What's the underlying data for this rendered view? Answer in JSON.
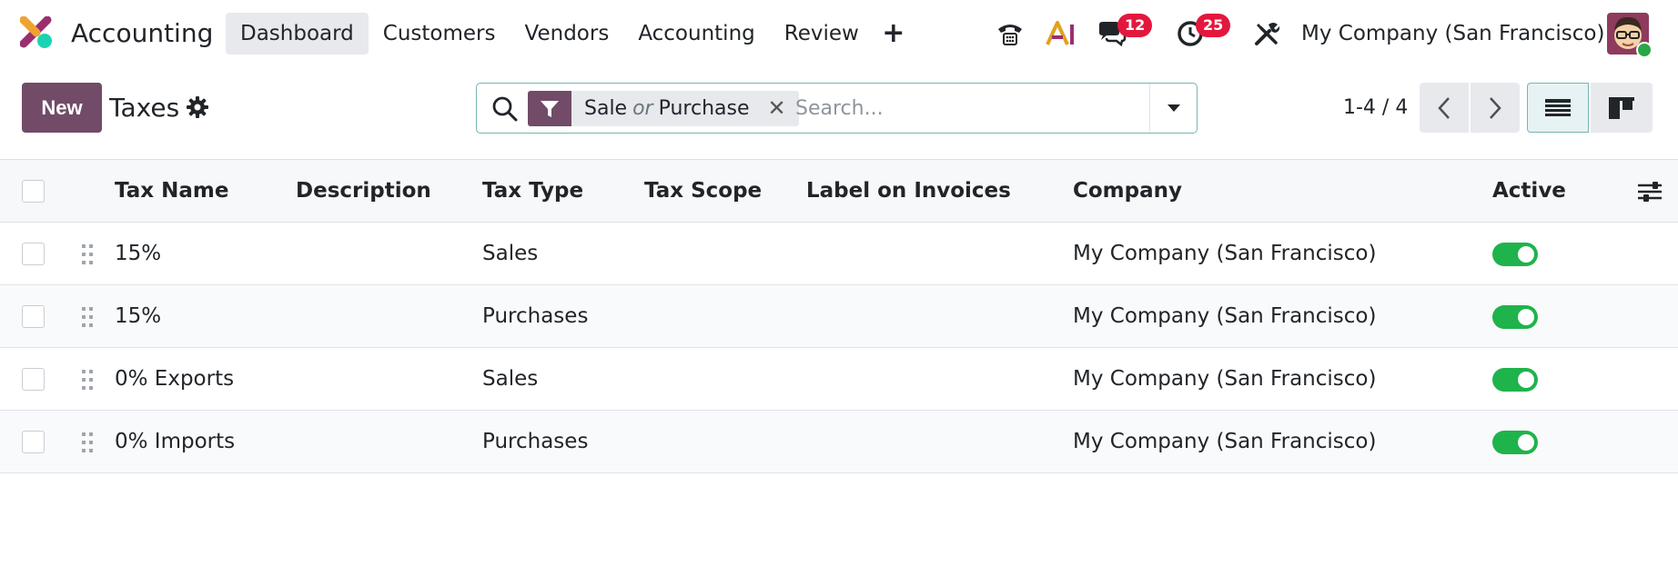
{
  "app": {
    "name": "Accounting",
    "brand_color": "#714b67",
    "logo_icon": "odoo-accounting-logo"
  },
  "navbar": {
    "menu": [
      {
        "label": "Dashboard",
        "active": true
      },
      {
        "label": "Customers",
        "active": false
      },
      {
        "label": "Vendors",
        "active": false
      },
      {
        "label": "Accounting",
        "active": false
      },
      {
        "label": "Review",
        "active": false
      }
    ],
    "add_icon": "plus-icon",
    "systray": {
      "phone_icon": "phone-icon",
      "ai_icon": "ai-icon",
      "messages_icon": "chat-icon",
      "messages_count": "12",
      "activities_icon": "clock-icon",
      "activities_count": "25",
      "tools_icon": "tools-icon",
      "company": "My Company (San Francisco)"
    }
  },
  "control_panel": {
    "new_label": "New",
    "title": "Taxes",
    "search": {
      "facet_icon": "filter-icon",
      "facet_values": [
        "Sale",
        "Purchase"
      ],
      "facet_separator": "or",
      "facet_remove": "✕",
      "placeholder": "Search..."
    },
    "pager": "1-4 / 4",
    "views": [
      "list",
      "kanban"
    ]
  },
  "table": {
    "columns": [
      "Tax Name",
      "Description",
      "Tax Type",
      "Tax Scope",
      "Label on Invoices",
      "Company",
      "Active"
    ],
    "rows": [
      {
        "name": "15%",
        "description": "",
        "type": "Sales",
        "scope": "",
        "label": "",
        "company": "My Company (San Francisco)",
        "active": true
      },
      {
        "name": "15%",
        "description": "",
        "type": "Purchases",
        "scope": "",
        "label": "",
        "company": "My Company (San Francisco)",
        "active": true
      },
      {
        "name": "0% Exports",
        "description": "",
        "type": "Sales",
        "scope": "",
        "label": "",
        "company": "My Company (San Francisco)",
        "active": true
      },
      {
        "name": "0% Imports",
        "description": "",
        "type": "Purchases",
        "scope": "",
        "label": "",
        "company": "My Company (San Francisco)",
        "active": true
      }
    ]
  },
  "colors": {
    "badge": "#e3173d",
    "toggle_on": "#1fb34c",
    "search_border": "#76b4b1"
  }
}
